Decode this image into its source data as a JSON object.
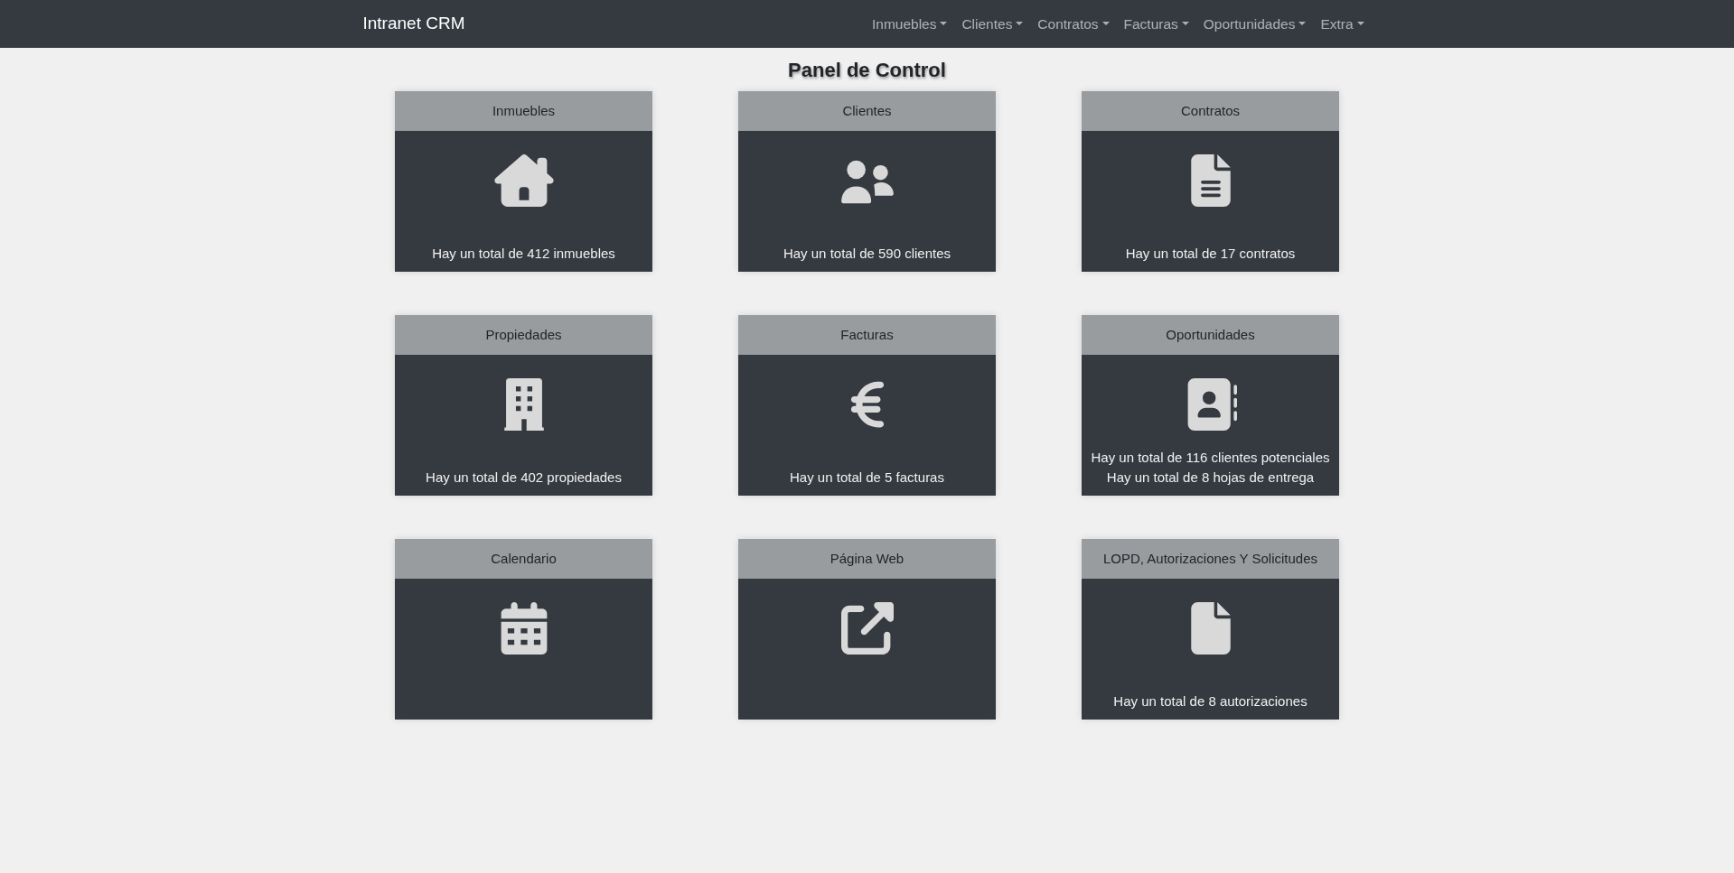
{
  "navbar": {
    "brand": "Intranet CRM",
    "menus": [
      "Inmuebles",
      "Clientes",
      "Contratos",
      "Facturas",
      "Oportunidades",
      "Extra"
    ]
  },
  "page_title": "Panel de Control",
  "cards": [
    {
      "title": "Inmuebles",
      "lines": [
        "Hay un total de 412 inmuebles"
      ]
    },
    {
      "title": "Clientes",
      "lines": [
        "Hay un total de 590 clientes"
      ]
    },
    {
      "title": "Contratos",
      "lines": [
        "Hay un total de 17 contratos"
      ]
    },
    {
      "title": "Propiedades",
      "lines": [
        "Hay un total de 402 propiedades"
      ]
    },
    {
      "title": "Facturas",
      "lines": [
        "Hay un total de 5 facturas"
      ]
    },
    {
      "title": "Oportunidades",
      "lines": [
        "Hay un total de 116 clientes potenciales",
        "Hay un total de 8 hojas de entrega"
      ]
    },
    {
      "title": "Calendario"
    },
    {
      "title": "Página Web"
    },
    {
      "title": "LOPD, Autorizaciones Y Solicitudes",
      "lines": [
        "Hay un total de 8 autorizaciones"
      ]
    }
  ]
}
